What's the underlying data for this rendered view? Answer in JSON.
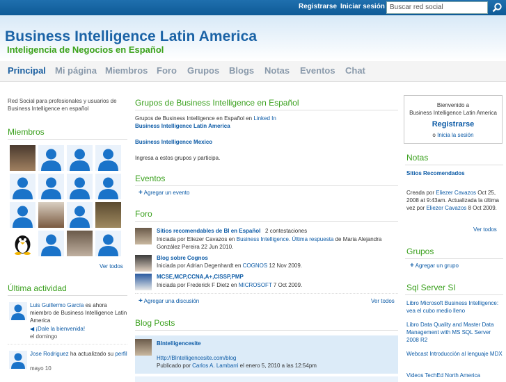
{
  "topbar": {
    "register": "Registrarse",
    "login": "Iniciar sesión",
    "search_placeholder": "Buscar red social"
  },
  "header": {
    "title": "Business Intelligence Latin America",
    "subtitle": "Inteligencia de Negocios en Español"
  },
  "nav": [
    "Principal",
    "Mi página",
    "Miembros",
    "Foro",
    "Grupos",
    "Blogs",
    "Notas",
    "Eventos",
    "Chat"
  ],
  "left": {
    "intro": "Red Social para profesionales y usuarios de Business Intelligence en español",
    "members_title": "Miembros",
    "see_all": "Ver todos",
    "activity_title": "Última actividad",
    "activity": [
      {
        "name": "Luis Guillermo García",
        "text": " es ahora miembro de Business Intelligence Latin America",
        "welcome": "¡Dale la bienvenida!",
        "time": "el domingo"
      },
      {
        "name": "Jose Rodriguez",
        "text": " ha actualizado su ",
        "link": "perfil",
        "time": "mayo 10"
      }
    ]
  },
  "mid": {
    "groups_title": "Grupos de Business Intelligence en Español",
    "groups_text": "Grupos de Business Intelligence en Español en ",
    "groups_link": "Linked In",
    "group1": "Business Intelligence Latin America",
    "group2": "Business Intelligence Mexico",
    "groups_cta": "Ingresa a estos grupos y participa.",
    "events_title": "Eventos",
    "add_event": "Agregar un evento",
    "forum_title": "Foro",
    "forum": [
      {
        "title": "Sitios recomendables de BI en Español",
        "count": "2 contestaciones",
        "l1a": "Iniciada por Eliezer Cavazos en ",
        "l1b": "Business Intelligence",
        "l1c": ". ",
        "l1d": "Última respuesta",
        "l1e": " de Maria Alejandra",
        "l2": "González Pereira 22 Jun 2010."
      },
      {
        "title": "Blog sobre Cognos",
        "l1a": "Iniciada por Adrian Degenhardt en ",
        "l1b": "COGNOS",
        "l1c": " 12 Nov 2009."
      },
      {
        "title": "MCSE,MCP,CCNA,A+,CISSP,PMP",
        "l1a": "Iniciada por Frederick F Dietz en ",
        "l1b": "MICROSOFT",
        "l1c": " 7 Oct 2009."
      }
    ],
    "add_discussion": "Agregar una discusión",
    "see_all": "Ver todos",
    "blog_title": "Blog Posts",
    "blog": {
      "title": "BIntelligencesite",
      "url": "Http://BIntelligencesite.com/blog",
      "by_a": "Publicado por ",
      "by_b": "Carlos A. Lambarri",
      "by_c": " el enero 5, 2010 a las 12:54pm"
    }
  },
  "right": {
    "welcome": "Bienvenido a",
    "site": "Business Intelligence Latin America",
    "register": "Registrarse",
    "or": "o ",
    "login": "Inicia la sesión",
    "notes_title": "Notas",
    "note_title": "Sitios Recomendados",
    "note_a": "Creada por ",
    "note_b": "Eliezer Cavazos",
    "note_c": " Oct 25, 2008 at 9:43am. Actualizada la última vez por ",
    "note_d": "Eliezer Cavazos",
    "note_e": " 8 Oct 2009.",
    "see_all": "Ver todos",
    "groups_title": "Grupos",
    "add_group": "Agregar un grupo",
    "sql_title": "Sql Server SI",
    "sql_links": [
      "Libro Microsoft Business Intelligence: vea el cubo medio lleno",
      "Libro Data Quality and Master Data Management with MS SQL Server 2008 R2",
      "Webcast Introducción al lenguaje MDX",
      "Videos TechEd North America"
    ]
  }
}
